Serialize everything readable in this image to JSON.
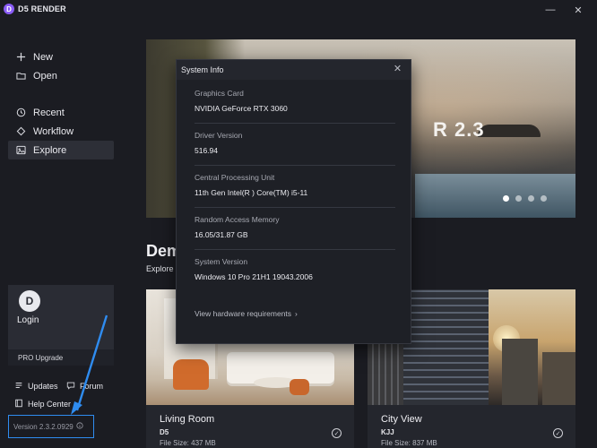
{
  "app": {
    "logo_letter": "D",
    "title": "D5 RENDER",
    "minimize_glyph": "—",
    "close_glyph": "✕"
  },
  "sidebar": {
    "top_items": [
      {
        "label": "New",
        "icon": "plus-icon"
      },
      {
        "label": "Open",
        "icon": "folder-icon"
      }
    ],
    "nav_items": [
      {
        "label": "Recent",
        "icon": "clock-icon"
      },
      {
        "label": "Workflow",
        "icon": "workflow-icon"
      },
      {
        "label": "Explore",
        "icon": "explore-icon",
        "active": true
      }
    ],
    "login": {
      "avatar_letter": "D",
      "label": "Login",
      "pro_upgrade": "PRO Upgrade"
    },
    "updates_label": "Updates",
    "forum_label": "Forum",
    "help_center_label": "Help Center",
    "version": "Version 2.3.2.0929"
  },
  "hero": {
    "visible_text": "R 2.3",
    "slides": 4,
    "active_slide": 0
  },
  "section": {
    "title_fragment": "Dem",
    "subtitle_fragment": "Explore l"
  },
  "cards": [
    {
      "title": "Living Room",
      "author": "D5",
      "file_size": "File Size: 437 MB"
    },
    {
      "title": "City View",
      "author": "KJJ",
      "file_size": "File Size: 837 MB"
    }
  ],
  "modal": {
    "title": "System Info",
    "close_glyph": "✕",
    "items": [
      {
        "label": "Graphics Card",
        "value": "NVIDIA GeForce RTX 3060"
      },
      {
        "label": "Driver Version",
        "value": "516.94"
      },
      {
        "label": "Central Processing Unit",
        "value": "11th Gen Intel(R ) Core(TM) i5-11"
      },
      {
        "label": "Random Access Memory",
        "value": "16.05/31.87 GB"
      },
      {
        "label": "System Version",
        "value": "Windows 10 Pro 21H1 19043.2006"
      }
    ],
    "hardware_link": "View hardware requirements",
    "hardware_link_chevron": "›"
  },
  "colors": {
    "background": "#1b1c22",
    "accent_blue": "#2f8cf0",
    "logo_purple": "#8a5cf6",
    "modal_bg": "#1e2026"
  }
}
